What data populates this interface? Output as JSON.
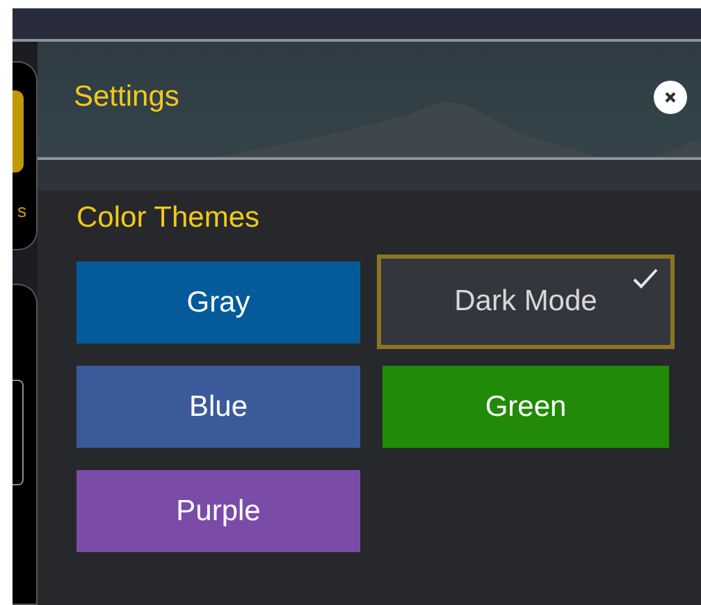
{
  "sidebar": {
    "items": [
      {
        "label": "s",
        "selected": true
      },
      {
        "selected": false
      }
    ]
  },
  "panel": {
    "title": "Settings"
  },
  "section": {
    "title": "Color Themes"
  },
  "themes": [
    {
      "label": "Gray",
      "color": "#055b9a",
      "selected": false
    },
    {
      "label": "Dark Mode",
      "color": "#33363d",
      "selected": true
    },
    {
      "label": "Blue",
      "color": "#3b5a9a",
      "selected": false
    },
    {
      "label": "Green",
      "color": "#218a08",
      "selected": false
    },
    {
      "label": "Purple",
      "color": "#7b4ba8",
      "selected": false
    }
  ]
}
